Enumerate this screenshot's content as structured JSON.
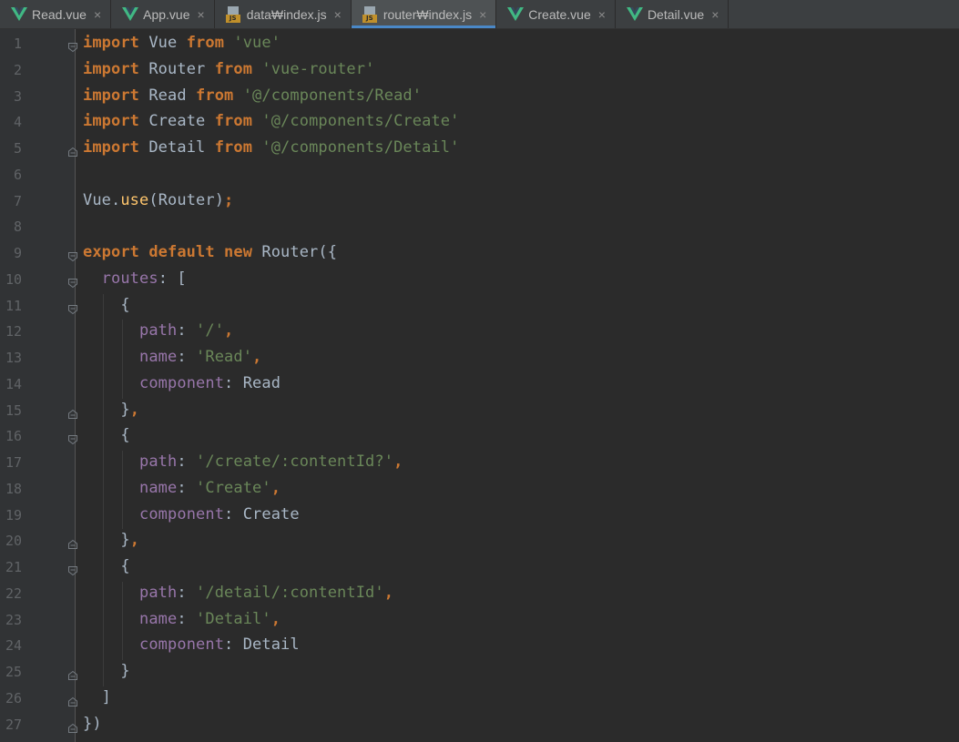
{
  "tabs": [
    {
      "label": "Read.vue",
      "type": "vue",
      "active": false
    },
    {
      "label": "App.vue",
      "type": "vue",
      "active": false
    },
    {
      "label": "data₩index.js",
      "type": "js",
      "active": false
    },
    {
      "label": "router₩index.js",
      "type": "js",
      "active": true
    },
    {
      "label": "Create.vue",
      "type": "vue",
      "active": false
    },
    {
      "label": "Detail.vue",
      "type": "vue",
      "active": false
    }
  ],
  "close_glyph": "×",
  "js_badge": "JS",
  "icons": {
    "vue": "vue-file-icon",
    "js": "js-file-icon",
    "close": "close-icon",
    "fold_open": "fold-open-icon",
    "fold_close": "fold-close-icon"
  },
  "colors": {
    "keyword": "#cc7832",
    "string": "#6a8759",
    "property": "#9876aa",
    "function": "#ffc66d",
    "text": "#a9b7c6",
    "vue_green": "#41b883",
    "active_tab_underline": "#4a88c7"
  },
  "line_numbers": [
    "1",
    "2",
    "3",
    "4",
    "5",
    "6",
    "7",
    "8",
    "9",
    "10",
    "11",
    "12",
    "13",
    "14",
    "15",
    "16",
    "17",
    "18",
    "19",
    "20",
    "21",
    "22",
    "23",
    "24",
    "25",
    "26",
    "27"
  ],
  "code_lines": [
    [
      [
        "kw",
        "import"
      ],
      [
        "t",
        " Vue "
      ],
      [
        "kw",
        "from"
      ],
      [
        "t",
        " "
      ],
      [
        "str",
        "'vue'"
      ]
    ],
    [
      [
        "kw",
        "import"
      ],
      [
        "t",
        " Router "
      ],
      [
        "kw",
        "from"
      ],
      [
        "t",
        " "
      ],
      [
        "str",
        "'vue-router'"
      ]
    ],
    [
      [
        "kw",
        "import"
      ],
      [
        "t",
        " Read "
      ],
      [
        "kw",
        "from"
      ],
      [
        "t",
        " "
      ],
      [
        "str",
        "'@/components/Read'"
      ]
    ],
    [
      [
        "kw",
        "import"
      ],
      [
        "t",
        " Create "
      ],
      [
        "kw",
        "from"
      ],
      [
        "t",
        " "
      ],
      [
        "str",
        "'@/components/Create'"
      ]
    ],
    [
      [
        "kw",
        "import"
      ],
      [
        "t",
        " Detail "
      ],
      [
        "kw",
        "from"
      ],
      [
        "t",
        " "
      ],
      [
        "str",
        "'@/components/Detail'"
      ]
    ],
    [],
    [
      [
        "t",
        "Vue."
      ],
      [
        "fn",
        "use"
      ],
      [
        "t",
        "(Router)"
      ],
      [
        "kw",
        ";"
      ]
    ],
    [],
    [
      [
        "kw",
        "export default new"
      ],
      [
        "t",
        " Router({"
      ]
    ],
    [
      [
        "t",
        "  "
      ],
      [
        "prop",
        "routes"
      ],
      [
        "t",
        ": ["
      ]
    ],
    [
      [
        "t",
        "    {"
      ]
    ],
    [
      [
        "t",
        "      "
      ],
      [
        "prop",
        "path"
      ],
      [
        "t",
        ": "
      ],
      [
        "str",
        "'/'"
      ],
      [
        "kw",
        ","
      ]
    ],
    [
      [
        "t",
        "      "
      ],
      [
        "prop",
        "name"
      ],
      [
        "t",
        ": "
      ],
      [
        "str",
        "'Read'"
      ],
      [
        "kw",
        ","
      ]
    ],
    [
      [
        "t",
        "      "
      ],
      [
        "prop",
        "component"
      ],
      [
        "t",
        ": Read"
      ]
    ],
    [
      [
        "t",
        "    }"
      ],
      [
        "kw",
        ","
      ]
    ],
    [
      [
        "t",
        "    {"
      ]
    ],
    [
      [
        "t",
        "      "
      ],
      [
        "prop",
        "path"
      ],
      [
        "t",
        ": "
      ],
      [
        "str",
        "'/create/:contentId?'"
      ],
      [
        "kw",
        ","
      ]
    ],
    [
      [
        "t",
        "      "
      ],
      [
        "prop",
        "name"
      ],
      [
        "t",
        ": "
      ],
      [
        "str",
        "'Create'"
      ],
      [
        "kw",
        ","
      ]
    ],
    [
      [
        "t",
        "      "
      ],
      [
        "prop",
        "component"
      ],
      [
        "t",
        ": Create"
      ]
    ],
    [
      [
        "t",
        "    }"
      ],
      [
        "kw",
        ","
      ]
    ],
    [
      [
        "t",
        "    {"
      ]
    ],
    [
      [
        "t",
        "      "
      ],
      [
        "prop",
        "path"
      ],
      [
        "t",
        ": "
      ],
      [
        "str",
        "'/detail/:contentId'"
      ],
      [
        "kw",
        ","
      ]
    ],
    [
      [
        "t",
        "      "
      ],
      [
        "prop",
        "name"
      ],
      [
        "t",
        ": "
      ],
      [
        "str",
        "'Detail'"
      ],
      [
        "kw",
        ","
      ]
    ],
    [
      [
        "t",
        "      "
      ],
      [
        "prop",
        "component"
      ],
      [
        "t",
        ": Detail"
      ]
    ],
    [
      [
        "t",
        "    }"
      ]
    ],
    [
      [
        "t",
        "  ]"
      ]
    ],
    [
      [
        "t",
        "})"
      ]
    ]
  ],
  "folds": {
    "1": "open",
    "5": "close",
    "9": "open",
    "10": "open",
    "11": "open",
    "15": "close",
    "16": "open",
    "20": "close",
    "21": "open",
    "25": "close",
    "26": "close",
    "27": "close"
  }
}
